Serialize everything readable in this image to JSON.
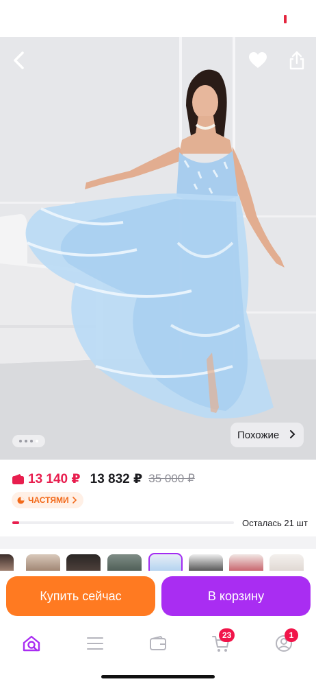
{
  "colors": {
    "accent_pink": "#e81e4e",
    "accent_orange": "#ff7a21",
    "accent_purple": "#a92df2",
    "dress_blue": "#a9d0f2"
  },
  "hero": {
    "back_icon": "chevron-left-icon",
    "favorite_icon": "heart-icon",
    "share_icon": "share-icon",
    "gallery_dots": 4,
    "gallery_active_index": 3,
    "similar_label": "Похожие"
  },
  "price": {
    "wallet_price": "13 140 ₽",
    "price": "13 832 ₽",
    "old_price": "35 000 ₽",
    "installments_label": "ЧАСТЯМИ",
    "stock_label": "Осталась 21 шт",
    "stock_fraction": 0.03
  },
  "thumbnails": {
    "count": 9,
    "selected_index": 4
  },
  "actions": {
    "buy_now": "Купить сейчас",
    "add_to_cart": "В корзину"
  },
  "tabbar": {
    "items": [
      {
        "name": "home",
        "icon": "search-home-icon"
      },
      {
        "name": "catalog",
        "icon": "menu-icon"
      },
      {
        "name": "wallet",
        "icon": "wallet-icon"
      },
      {
        "name": "cart",
        "icon": "cart-icon",
        "badge": "23"
      },
      {
        "name": "profile",
        "icon": "profile-icon",
        "badge": "1"
      }
    ]
  }
}
